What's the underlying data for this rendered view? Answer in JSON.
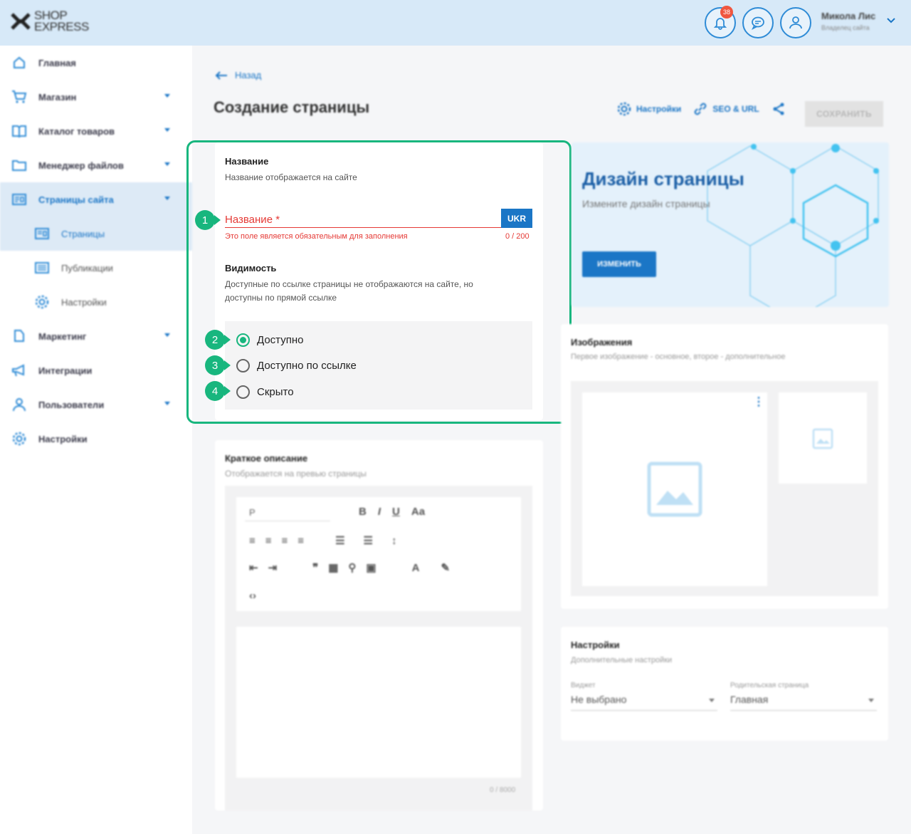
{
  "header": {
    "logo_line1": "SHOP",
    "logo_line2": "EXPRESS",
    "notifications_count": "38",
    "user_name": "Микола Лис",
    "user_role": "Владелец сайта"
  },
  "sidebar": {
    "items": [
      {
        "label": "Главная",
        "icon": "home-icon"
      },
      {
        "label": "Магазин",
        "icon": "cart-icon"
      },
      {
        "label": "Каталог товаров",
        "icon": "book-icon"
      },
      {
        "label": "Менеджер файлов",
        "icon": "folder-icon"
      },
      {
        "label": "Страницы сайта",
        "icon": "pages-icon"
      },
      {
        "label": "Страницы",
        "icon": "page-icon"
      },
      {
        "label": "Публикации",
        "icon": "news-icon"
      },
      {
        "label": "Настройки",
        "icon": "gear-icon"
      },
      {
        "label": "Маркетинг",
        "icon": "tag-icon"
      },
      {
        "label": "Интеграции",
        "icon": "megaphone-icon"
      },
      {
        "label": "Пользователи",
        "icon": "users-icon"
      },
      {
        "label": "Настройки",
        "icon": "gear-icon"
      }
    ]
  },
  "page": {
    "back_label": "Назад",
    "title": "Создание страницы",
    "actions": {
      "settings": "Настройки",
      "seo": "SEO & URL",
      "save": "СОХРАНИТЬ"
    }
  },
  "name_section": {
    "title": "Название",
    "subtitle": "Название отображается на сайте",
    "field_label": "Название *",
    "lang": "UKR",
    "error": "Это поле является обязательным для заполнения",
    "counter": "0 / 200"
  },
  "visibility": {
    "title": "Видимость",
    "subtitle_line1": "Доступные по ссылке страницы не отображаются на сайте, но",
    "subtitle_line2": "доступны по прямой ссылке",
    "options": [
      "Доступно",
      "Доступно по ссылке",
      "Скрыто"
    ],
    "selected": "Доступно"
  },
  "markers": [
    "1",
    "2",
    "3",
    "4"
  ],
  "description": {
    "title": "Краткое описание",
    "subtitle": "Отображается на превью страницы",
    "format_value": "P",
    "counter": "0 / 8000"
  },
  "design": {
    "title": "Дизайн страницы",
    "subtitle": "Измените дизайн страницы",
    "button": "ИЗМЕНИТЬ"
  },
  "images": {
    "title": "Изображения",
    "subtitle": "Первое изображение - основное, второе - дополнительное"
  },
  "settings_card": {
    "title": "Настройки",
    "subtitle": "Дополнительные настройки",
    "widget_label": "Виджет",
    "widget_value": "Не выбрано",
    "parent_label": "Родительская страница",
    "parent_value": "Главная"
  },
  "colors": {
    "accent": "#1b76c6",
    "highlight": "#18b67e",
    "error": "#e53935"
  }
}
